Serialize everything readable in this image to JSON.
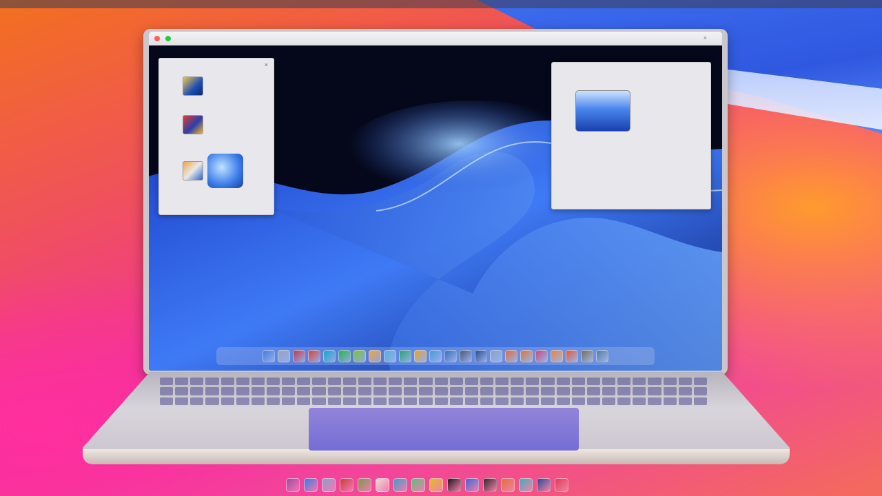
{
  "menubar": {
    "items": [
      "",
      "",
      "",
      "",
      "",
      "",
      ""
    ],
    "right_items": [
      "",
      "",
      "",
      "",
      ""
    ]
  },
  "window": {
    "title": ""
  },
  "left_panel": {
    "title": "",
    "items": [
      {
        "line1": "",
        "line2": ""
      },
      {
        "line1": "",
        "line2": ""
      },
      {
        "line1": "",
        "line2": ""
      }
    ]
  },
  "right_panel": {
    "title": "",
    "caption": "",
    "subcaption": ""
  },
  "colors": {
    "dock_icons": [
      "#4a7bd6",
      "#9aa3b8",
      "#c0394b",
      "#d4473a",
      "#1aa3c9",
      "#2bb24c",
      "#7ac13a",
      "#f0a33a",
      "#5bb0e0",
      "#2aa36a",
      "#e8a030",
      "#4a9ad6",
      "#3a6fb8",
      "#4a5a7a",
      "#2c4a8a",
      "#8aa0c8",
      "#e06a3a",
      "#d8783a",
      "#c84a7a",
      "#e8843a",
      "#e05a3a",
      "#7a6a5a",
      "#5a7a9a"
    ],
    "bottom_dock_icons": [
      "#a04aa0",
      "#3a7be0",
      "#8aa0c8",
      "#c8403a",
      "#7a9a4a",
      "#e8e0d0",
      "#3aa0c8",
      "#5ac07a",
      "#e0c020",
      "#1a1a1a",
      "#3a6ad6",
      "#2a2a2a",
      "#e0703a",
      "#3ab0c0",
      "#2a4a9a",
      "#e03a5a"
    ]
  }
}
